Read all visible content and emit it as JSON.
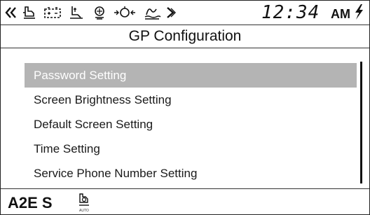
{
  "status_bar": {
    "icons": [
      "left-arrow-indicator-icon",
      "engine-oil-icon",
      "battery-icon",
      "coolant-temperature-icon",
      "air-filter-icon",
      "glow-plug-icon",
      "hydraulic-oil-icon",
      "right-arrow-indicator-icon",
      "lightning-icon"
    ],
    "time": "12:34",
    "ampm": "AM"
  },
  "header": {
    "title": "GP Configuration"
  },
  "menu": {
    "items": [
      {
        "label": "Password Setting",
        "selected": true
      },
      {
        "label": "Screen Brightness Setting",
        "selected": false
      },
      {
        "label": "Default Screen Setting",
        "selected": false
      },
      {
        "label": "Time Setting",
        "selected": false
      },
      {
        "label": "Service Phone Number Setting",
        "selected": false
      }
    ]
  },
  "footer": {
    "mode": "A2E S",
    "auto_label": "AUTO",
    "auto_icon": "auto-idle-icon"
  },
  "colors": {
    "selected_background": "#b4b4b4",
    "selected_text": "#ffffff",
    "text": "#1a1a1a",
    "border": "#333333"
  }
}
